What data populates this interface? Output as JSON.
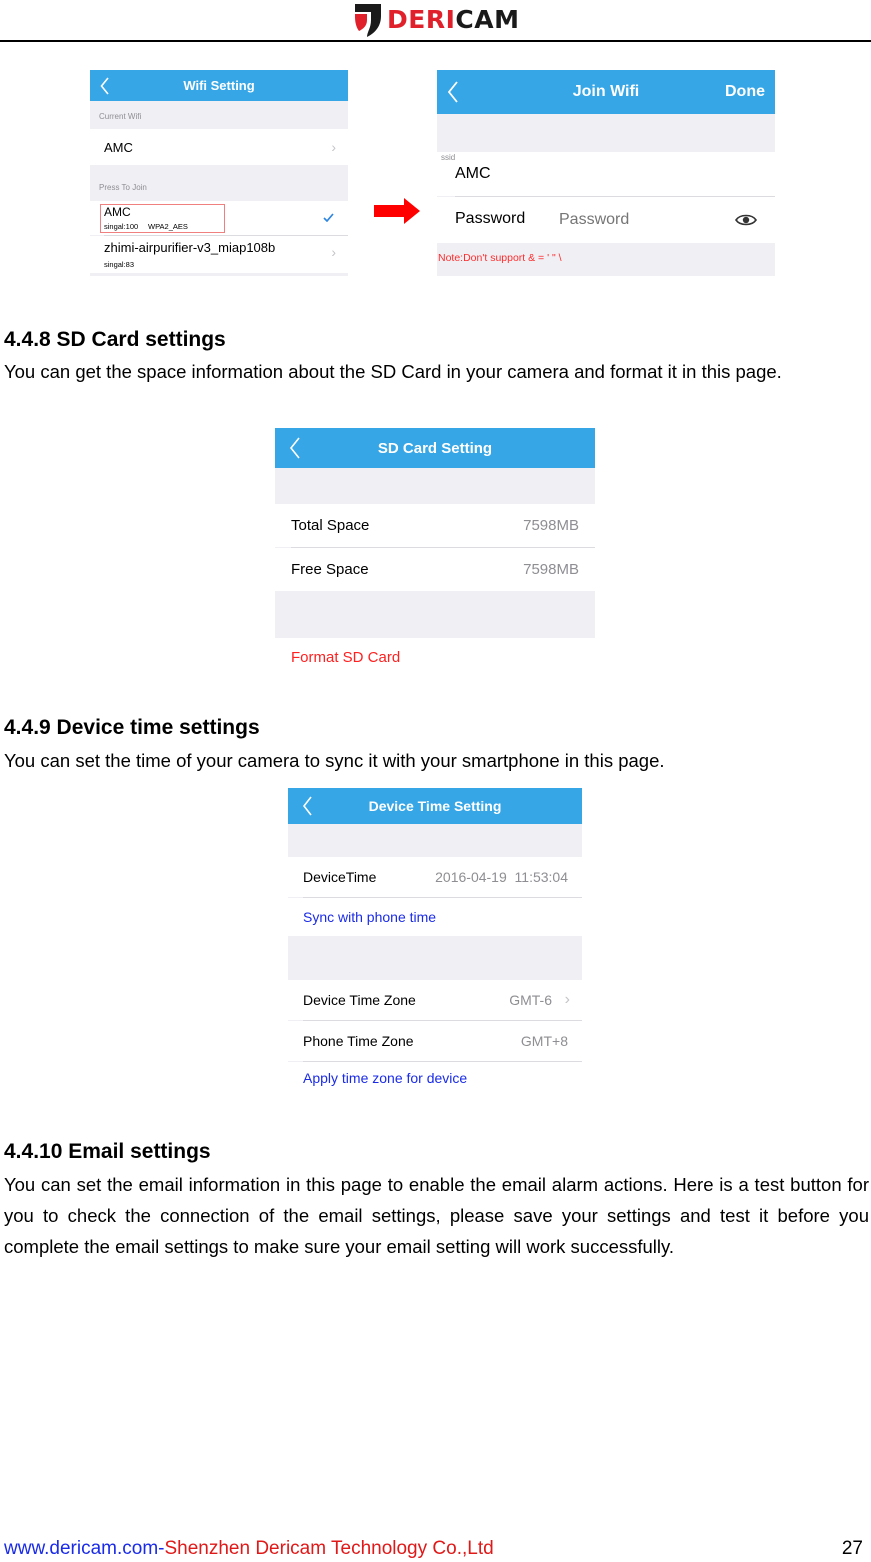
{
  "header": {
    "logo": {
      "red_part": "DERI",
      "dark_part": "CAM",
      "icon": "dericam-shield-icon"
    }
  },
  "wifi_setting_screen": {
    "title": "Wifi Setting",
    "back_icon": "chevron-left-icon",
    "current_wifi_label": "Current Wifi",
    "current_wifi": "AMC",
    "press_to_join_label": "Press To Join",
    "networks": [
      {
        "ssid": "AMC",
        "signal": "singal:100",
        "security": "WPA2_AES",
        "selected": true,
        "highlighted": true
      },
      {
        "ssid": "zhimi-airpurifier-v3_miap108b",
        "signal": "singal:83",
        "security": "",
        "selected": false,
        "highlighted": false
      }
    ]
  },
  "arrow": {
    "icon": "arrow-right-icon",
    "color": "#ff0000"
  },
  "join_wifi_screen": {
    "title": "Join Wifi",
    "done_label": "Done",
    "back_icon": "chevron-left-icon",
    "ssid_label": "ssid",
    "ssid_value": "AMC",
    "password_label": "Password",
    "password_placeholder": "Password",
    "eye_icon": "eye-icon",
    "note": "Note:Don't support & = ' \" \\"
  },
  "sections": [
    {
      "heading": "4.4.8 SD Card settings",
      "text": "You can get the space information about the SD Card in your camera and format it in this page."
    },
    {
      "heading": "4.4.9 Device time settings",
      "text": "You can set the time of your camera to sync it with your smartphone in this page."
    },
    {
      "heading": "4.4.10 Email settings",
      "text": "You can set the email information in this page to enable the email alarm actions. Here is a test button for you to check the connection of the email settings, please save your settings and test it before you complete the email settings to make sure your email setting will work successfully."
    }
  ],
  "sd_card_screen": {
    "title": "SD Card Setting",
    "rows": [
      {
        "label": "Total Space",
        "value": "7598MB"
      },
      {
        "label": "Free Space",
        "value": "7598MB"
      }
    ],
    "format_label": "Format SD Card"
  },
  "device_time_screen": {
    "title": "Device Time Setting",
    "device_time_label": "DeviceTime",
    "device_time_value": "2016-04-19  11:53:04",
    "sync_label": "Sync with phone time",
    "device_tz_label": "Device Time Zone",
    "device_tz_value": "GMT-6",
    "phone_tz_label": "Phone Time Zone",
    "phone_tz_value": "GMT+8",
    "apply_label": "Apply time zone for device"
  },
  "footer": {
    "website": "www.dericam.com-",
    "company": "Shenzhen Dericam Technology Co.,Ltd",
    "page_number": "27"
  },
  "colors": {
    "navbar": "#36a6e6",
    "link_blue": "#1a2be8",
    "alert_red": "#ff2d2d",
    "brand_red": "#e0202a"
  }
}
